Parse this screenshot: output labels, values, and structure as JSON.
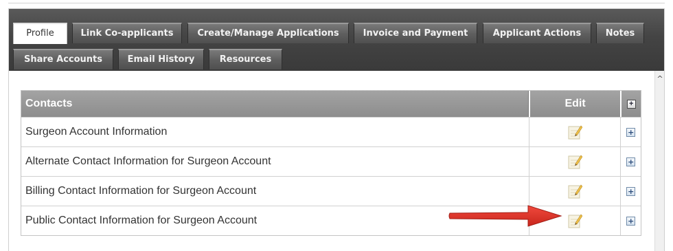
{
  "tabs_row1": [
    {
      "label": "Profile",
      "active": true
    },
    {
      "label": "Link Co-applicants",
      "active": false
    },
    {
      "label": "Create/Manage Applications",
      "active": false
    },
    {
      "label": "Invoice and Payment",
      "active": false
    },
    {
      "label": "Applicant Actions",
      "active": false
    },
    {
      "label": "Notes",
      "active": false
    }
  ],
  "tabs_row2": [
    {
      "label": "Share Accounts",
      "active": false
    },
    {
      "label": "Email History",
      "active": false
    },
    {
      "label": "Resources",
      "active": false
    }
  ],
  "contacts": {
    "header": {
      "label": "Contacts",
      "edit_label": "Edit",
      "expand_icon": "plus-icon"
    },
    "rows": [
      {
        "label": "Surgeon Account Information",
        "edit_icon": "notepad-pencil-icon",
        "expand_icon": "plus-icon"
      },
      {
        "label": "Alternate Contact Information for Surgeon Account",
        "edit_icon": "notepad-pencil-icon",
        "expand_icon": "plus-icon"
      },
      {
        "label": "Billing Contact Information for Surgeon Account",
        "edit_icon": "notepad-pencil-icon",
        "expand_icon": "plus-icon"
      },
      {
        "label": "Public Contact Information for Surgeon Account",
        "edit_icon": "notepad-pencil-icon",
        "expand_icon": "plus-icon"
      }
    ]
  },
  "colors": {
    "tab_bar": "#444444",
    "header_bg": "#999999",
    "arrow": "#e0352b"
  }
}
